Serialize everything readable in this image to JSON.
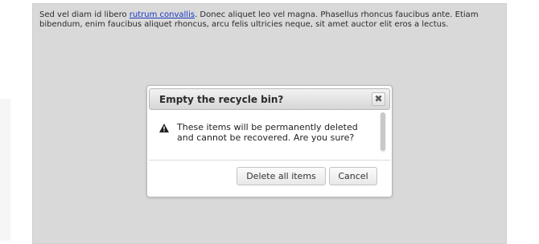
{
  "page": {
    "text_before_link": "Sed vel diam id libero ",
    "link_text": "rutrum convallis",
    "text_after_link": ". Donec aliquet leo vel magna. Phasellus rhoncus faucibus ante. Etiam bibendum, enim faucibus aliquet rhoncus, arcu felis ultricies neque, sit amet auctor elit eros a lectus."
  },
  "dialog": {
    "title": "Empty the recycle bin?",
    "close_symbol": "✖",
    "message": "These items will be permanently deleted and cannot be recovered. Are you sure?",
    "warning_icon": "warning-triangle-icon",
    "buttons": {
      "delete_label": "Delete all items",
      "cancel_label": "Cancel"
    }
  },
  "colors": {
    "overlay": "#d9d9d9",
    "link": "#1a38c2"
  }
}
